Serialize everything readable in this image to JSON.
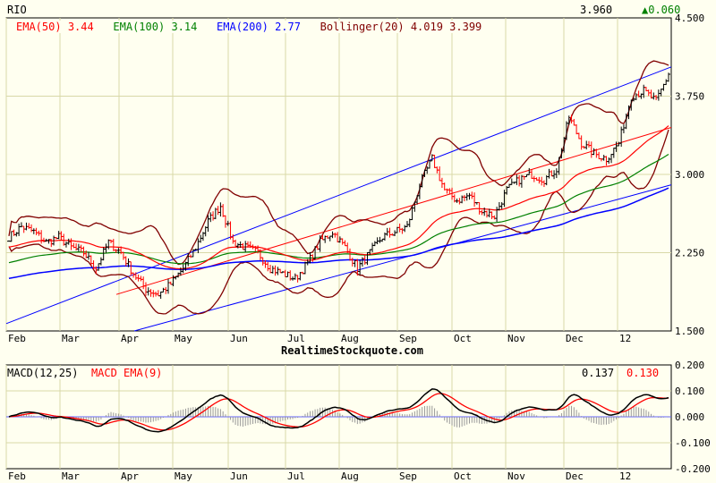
{
  "symbol": "RIO",
  "last_price": "3.960",
  "change": "▲0.060",
  "watermark": "RealtimeStockquote.com",
  "colors": {
    "bg": "#fffff0",
    "grid": "#d8d8a8",
    "price": "#000000",
    "down": "#ff0000",
    "ema50": "#ff0000",
    "ema100": "#008000",
    "ema200": "#0000ff",
    "bollinger": "#800000",
    "channel": "#0000ff",
    "change": "#008000"
  },
  "legend": {
    "ema50": "EMA(50)",
    "ema50_val": "3.44",
    "ema100": "EMA(100)",
    "ema100_val": "3.14",
    "ema200": "EMA(200)",
    "ema200_val": "2.77",
    "boll": "Bollinger(20)",
    "boll_val": "4.019 3.399"
  },
  "macd_legend": {
    "macd": "MACD(12,25)",
    "signal": "MACD EMA(9)",
    "macd_val": "0.137",
    "signal_val": "0.130"
  },
  "chart_data": [
    {
      "type": "ohlc",
      "ylim": [
        1.5,
        4.5
      ],
      "yticks": [
        "4.500",
        "3.750",
        "3.000",
        "2.250",
        "1.500"
      ],
      "x_labels": [
        "Feb",
        "Mar",
        "Apr",
        "May",
        "Jun",
        "Jul",
        "Aug",
        "Sep",
        "Oct",
        "Nov",
        "Dec",
        "12"
      ],
      "grid": true,
      "weekly_close": [
        2.4,
        2.5,
        2.45,
        2.35,
        2.4,
        2.3,
        2.25,
        2.1,
        2.35,
        2.25,
        2.05,
        1.9,
        1.85,
        1.95,
        2.1,
        2.3,
        2.55,
        2.7,
        2.35,
        2.3,
        2.25,
        2.1,
        2.05,
        2.0,
        2.15,
        2.35,
        2.45,
        2.3,
        2.1,
        2.25,
        2.4,
        2.45,
        2.5,
        2.9,
        3.15,
        2.85,
        2.75,
        2.8,
        2.65,
        2.6,
        2.85,
        2.95,
        3.0,
        2.95,
        3.05,
        3.55,
        3.3,
        3.2,
        3.15,
        3.3,
        3.75,
        3.8,
        3.7,
        3.96
      ],
      "channel": {
        "upper": [
          1.57,
          4.03
        ],
        "middle": [
          1.85,
          3.45
        ],
        "lower": [
          1.5,
          2.9
        ]
      }
    },
    {
      "type": "line",
      "ylim": [
        -0.2,
        0.2
      ],
      "yticks": [
        "0.200",
        "0.100",
        "0.000",
        "-0.100",
        "-0.200"
      ]
    }
  ]
}
